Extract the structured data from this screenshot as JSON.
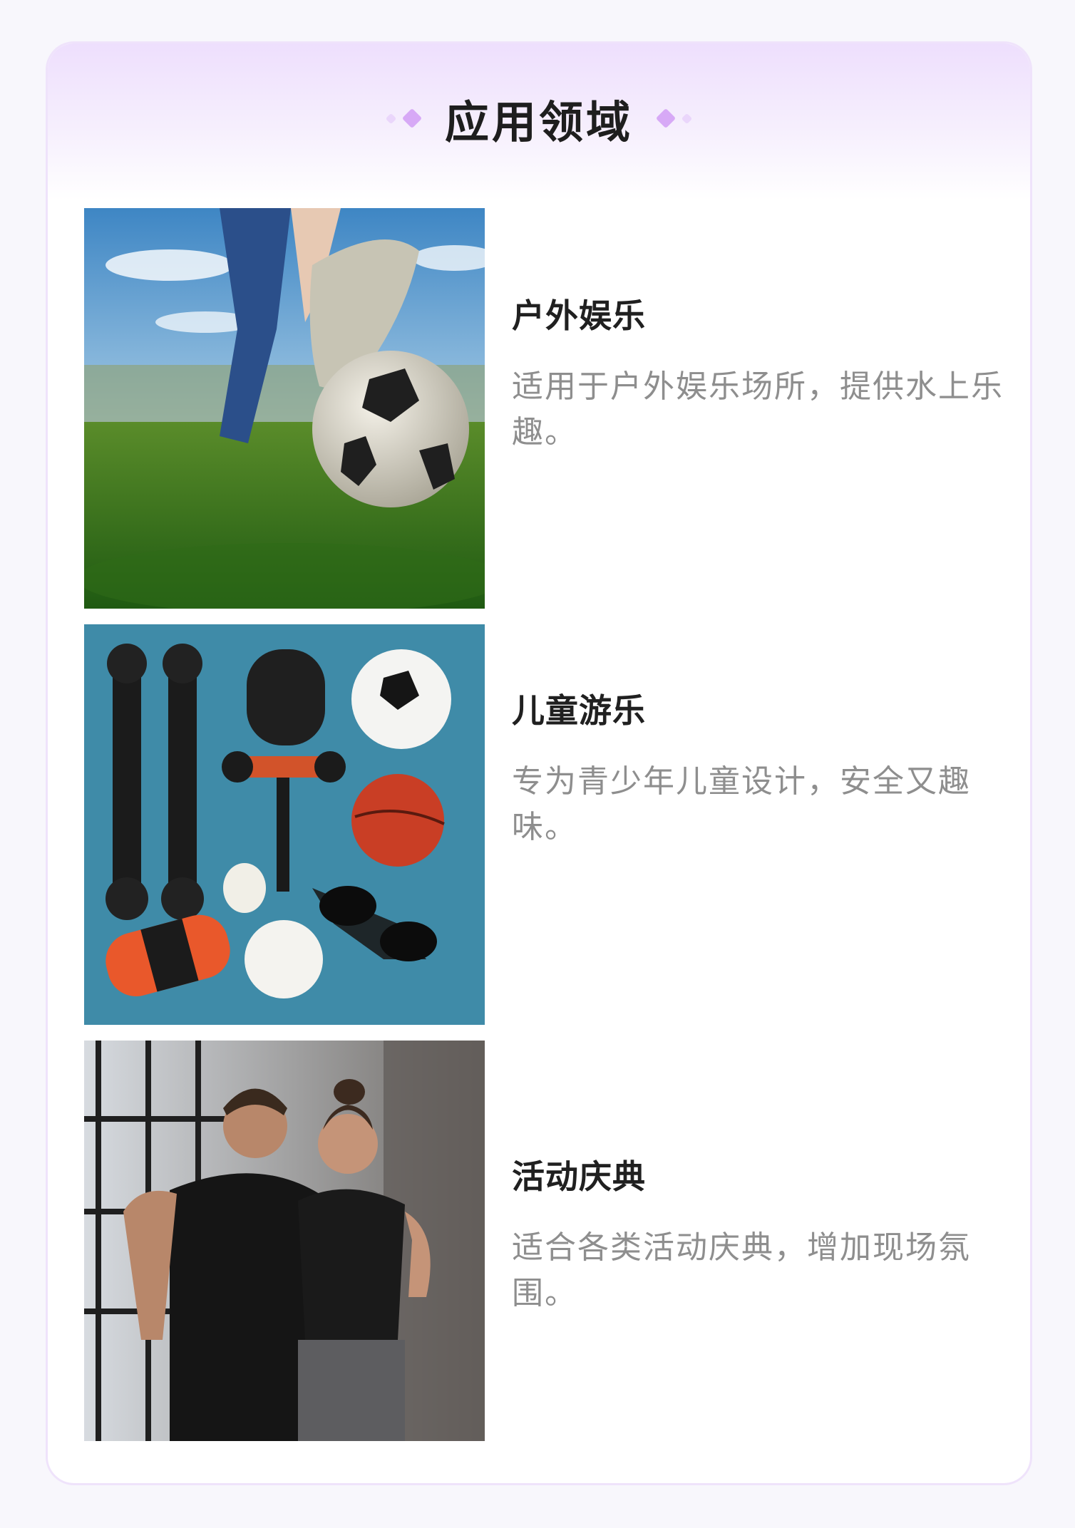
{
  "header": {
    "title": "应用领域",
    "accent_color": "#d7a9f6"
  },
  "items": [
    {
      "title": "户外娱乐",
      "description": "适用于户外娱乐场所，提供水上乐趣。",
      "image_subject": "soccer ball kicked on grass field"
    },
    {
      "title": "儿童游乐",
      "description": "专为青少年儿童设计，安全又趣味。",
      "image_subject": "sports equipment flat lay on blue background"
    },
    {
      "title": "活动庆典",
      "description": "适合各类活动庆典，增加现场氛围。",
      "image_subject": "two athletes in black sportswear"
    }
  ]
}
